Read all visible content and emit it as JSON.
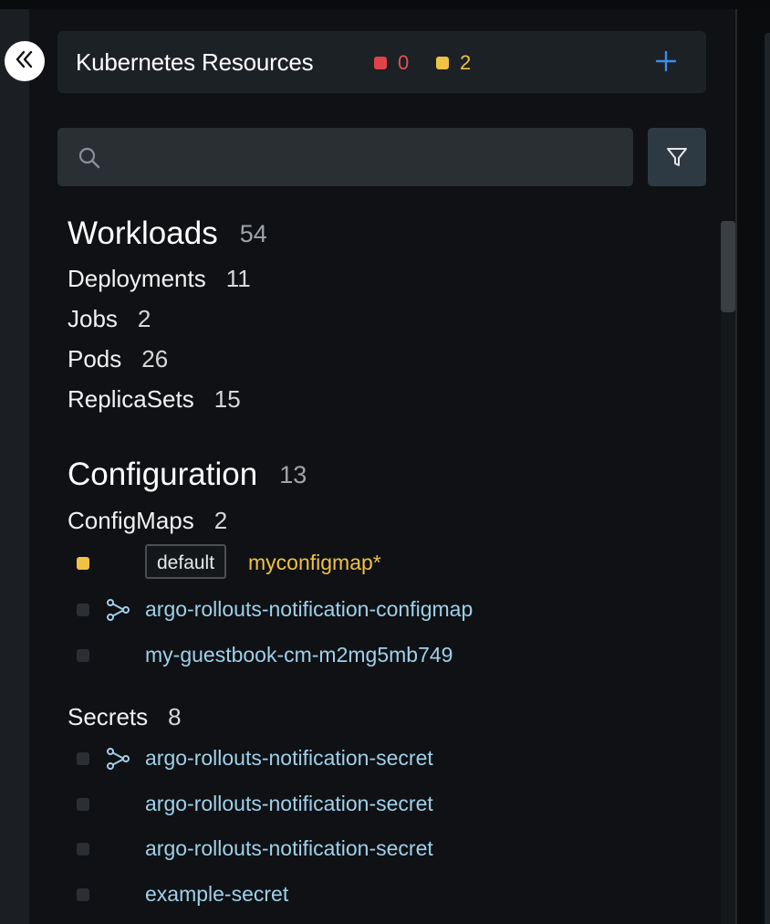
{
  "header": {
    "title": "Kubernetes Resources",
    "error_count": "0",
    "warning_count": "2",
    "colors": {
      "error": "#e0424a",
      "warning": "#f0c244",
      "accent": "#3b8eea"
    },
    "add_icon": "plus-icon",
    "collapse_icon": "double-chevron-left-icon"
  },
  "search": {
    "value": "",
    "placeholder": "",
    "icon": "search-icon"
  },
  "filter": {
    "icon": "filter-icon"
  },
  "groups": [
    {
      "title": "Workloads",
      "count": "54",
      "kinds": [
        {
          "label": "Deployments",
          "count": "11"
        },
        {
          "label": "Jobs",
          "count": "2"
        },
        {
          "label": "Pods",
          "count": "26"
        },
        {
          "label": "ReplicaSets",
          "count": "15"
        }
      ]
    },
    {
      "title": "Configuration",
      "count": "13",
      "kinds": [
        {
          "label": "ConfigMaps",
          "count": "2",
          "items": [
            {
              "namespace": "default",
              "name": "myconfigmap*",
              "status": "warning"
            },
            {
              "name": "argo-rollouts-notification-configmap",
              "status": "none",
              "icon": "relationship-icon"
            },
            {
              "name": "my-guestbook-cm-m2mg5mb749",
              "status": "none"
            }
          ]
        },
        {
          "label": "Secrets",
          "count": "8",
          "items": [
            {
              "name": "argo-rollouts-notification-secret",
              "status": "none",
              "icon": "relationship-icon"
            },
            {
              "name": "argo-rollouts-notification-secret",
              "status": "none"
            },
            {
              "name": "argo-rollouts-notification-secret",
              "status": "none"
            },
            {
              "name": "example-secret",
              "status": "none"
            }
          ]
        }
      ]
    }
  ]
}
